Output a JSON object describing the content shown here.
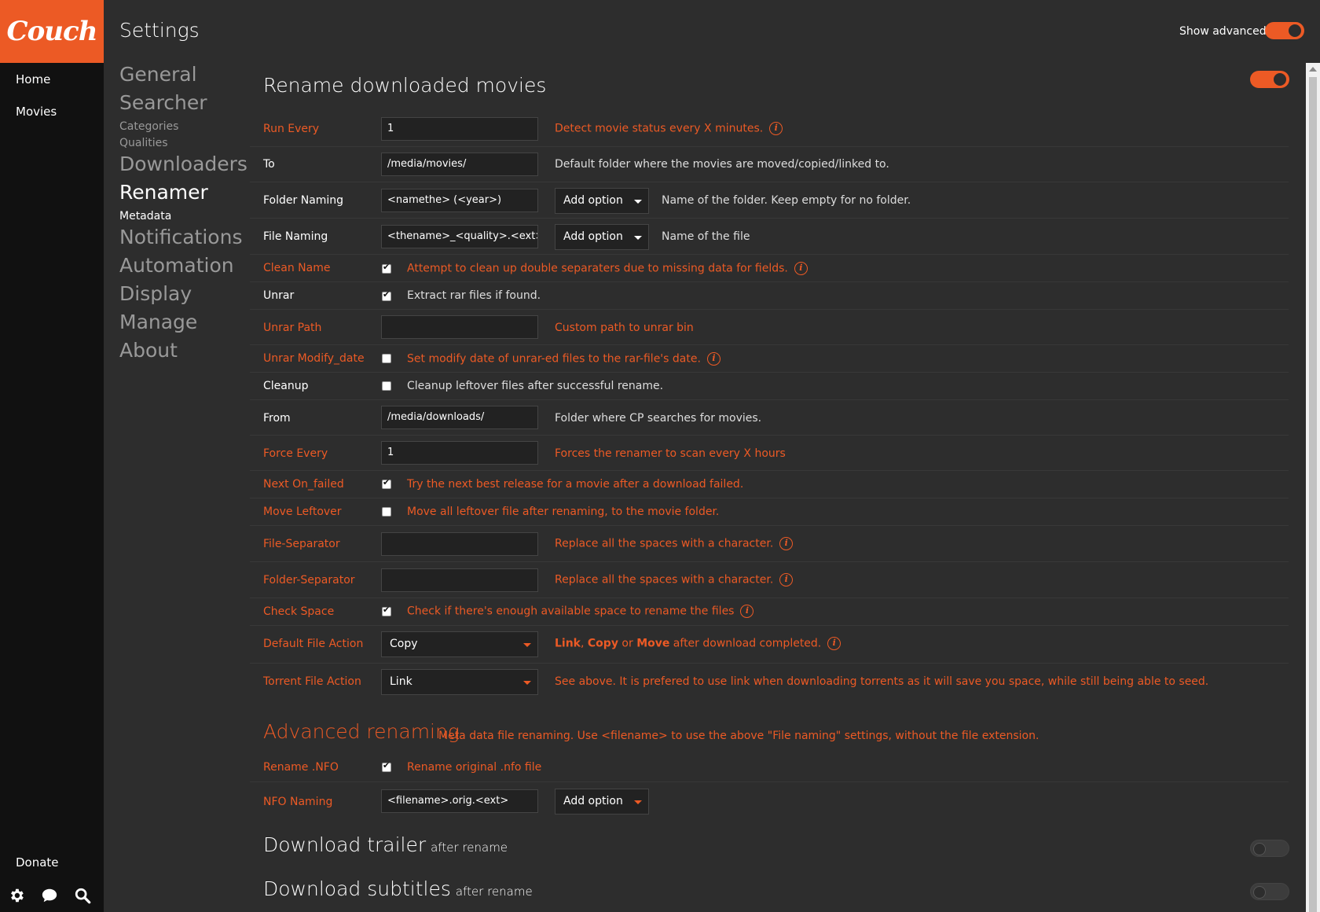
{
  "app": {
    "logo": "Couch",
    "nav": {
      "home": "Home",
      "movies": "Movies",
      "donate": "Donate"
    },
    "bottom_icons": [
      "gear-icon",
      "chat-bubble-icon",
      "search-icon"
    ]
  },
  "header": {
    "title": "Settings",
    "show_advanced_label": "Show advanced",
    "show_advanced_on": true
  },
  "subnav": {
    "general": "General",
    "searcher": "Searcher",
    "categories": "Categories",
    "qualities": "Qualities",
    "downloaders": "Downloaders",
    "renamer": "Renamer",
    "metadata": "Metadata",
    "notifications": "Notifications",
    "automation": "Automation",
    "display": "Display",
    "manage": "Manage",
    "about": "About"
  },
  "section": {
    "title": "Rename downloaded movies",
    "enabled": true
  },
  "rows": {
    "run_every": {
      "label": "Run Every",
      "value": "1",
      "desc": "Detect movie status every X minutes."
    },
    "to": {
      "label": "To",
      "value": "/media/movies/",
      "desc": "Default folder where the movies are moved/copied/linked to."
    },
    "folder_naming": {
      "label": "Folder Naming",
      "value": "<namethe> (<year>)",
      "add_option": "Add option",
      "desc": "Name of the folder. Keep empty for no folder."
    },
    "file_naming": {
      "label": "File Naming",
      "value": "<thename>_<quality>.<ext>",
      "add_option": "Add option",
      "desc": "Name of the file"
    },
    "clean_name": {
      "label": "Clean Name",
      "checked": true,
      "desc": "Attempt to clean up double separaters due to missing data for fields."
    },
    "unrar": {
      "label": "Unrar",
      "checked": true,
      "desc": "Extract rar files if found."
    },
    "unrar_path": {
      "label": "Unrar Path",
      "value": "",
      "desc": "Custom path to unrar bin"
    },
    "unrar_modify_date": {
      "label": "Unrar Modify_date",
      "checked": false,
      "desc": "Set modify date of unrar-ed files to the rar-file's date."
    },
    "cleanup": {
      "label": "Cleanup",
      "checked": false,
      "desc": "Cleanup leftover files after successful rename."
    },
    "from": {
      "label": "From",
      "value": "/media/downloads/",
      "desc": "Folder where CP searches for movies."
    },
    "force_every": {
      "label": "Force Every",
      "value": "1",
      "desc": "Forces the renamer to scan every X hours"
    },
    "next_on_failed": {
      "label": "Next On_failed",
      "checked": true,
      "desc": "Try the next best release for a movie after a download failed."
    },
    "move_leftover": {
      "label": "Move Leftover",
      "checked": false,
      "desc": "Move all leftover file after renaming, to the movie folder."
    },
    "file_separator": {
      "label": "File-Separator",
      "value": "",
      "desc": "Replace all the spaces with a character."
    },
    "folder_separator": {
      "label": "Folder-Separator",
      "value": "",
      "desc": "Replace all the spaces with a character."
    },
    "check_space": {
      "label": "Check Space",
      "checked": true,
      "desc": "Check if there's enough available space to rename the files"
    },
    "default_file_action": {
      "label": "Default File Action",
      "value": "Copy",
      "desc_link": "Link",
      "desc_comma": ", ",
      "desc_copy": "Copy",
      "desc_or": " or ",
      "desc_move": "Move",
      "desc_rest": " after download completed."
    },
    "torrent_file_action": {
      "label": "Torrent File Action",
      "value": "Link",
      "desc": "See above. It is prefered to use link when downloading torrents as it will save you space, while still being able to seed."
    }
  },
  "advanced_renaming": {
    "title": "Advanced renaming",
    "desc": "Meta data file renaming. Use <filename> to use the above \"File naming\" settings, without the file extension.",
    "rename_nfo": {
      "label": "Rename .NFO",
      "checked": true,
      "desc": "Rename original .nfo file"
    },
    "nfo_naming": {
      "label": "NFO Naming",
      "value": "<filename>.orig.<ext>",
      "add_option": "Add option"
    }
  },
  "groups": {
    "download_trailer": {
      "title": "Download trailer",
      "sub": "after rename",
      "enabled": false
    },
    "download_subtitles": {
      "title": "Download subtitles",
      "sub": "after rename",
      "enabled": false
    }
  },
  "colors": {
    "accent": "#ec5a25",
    "background": "#2d2d2d",
    "sidebar": "#111111"
  }
}
